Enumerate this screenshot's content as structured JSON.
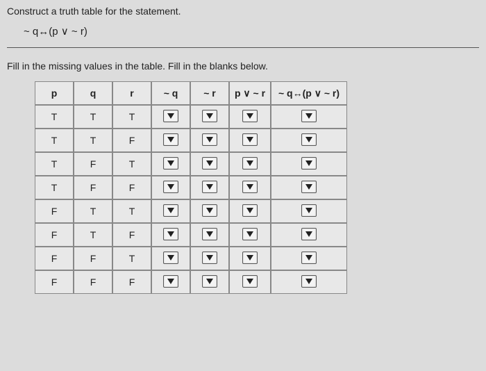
{
  "prompt": {
    "line1": "Construct a truth table for the statement.",
    "formula": "~ q↔(p ∨ ~ r)"
  },
  "instruction": "Fill in the missing values in the table. Fill in the blanks below.",
  "table": {
    "headers": [
      "p",
      "q",
      "r",
      "~ q",
      "~ r",
      "p ∨ ~ r",
      "~ q↔(p ∨ ~ r)"
    ],
    "rows": [
      {
        "p": "T",
        "q": "T",
        "r": "T"
      },
      {
        "p": "T",
        "q": "T",
        "r": "F"
      },
      {
        "p": "T",
        "q": "F",
        "r": "T"
      },
      {
        "p": "T",
        "q": "F",
        "r": "F"
      },
      {
        "p": "F",
        "q": "T",
        "r": "T"
      },
      {
        "p": "F",
        "q": "T",
        "r": "F"
      },
      {
        "p": "F",
        "q": "F",
        "r": "T"
      },
      {
        "p": "F",
        "q": "F",
        "r": "F"
      }
    ]
  }
}
